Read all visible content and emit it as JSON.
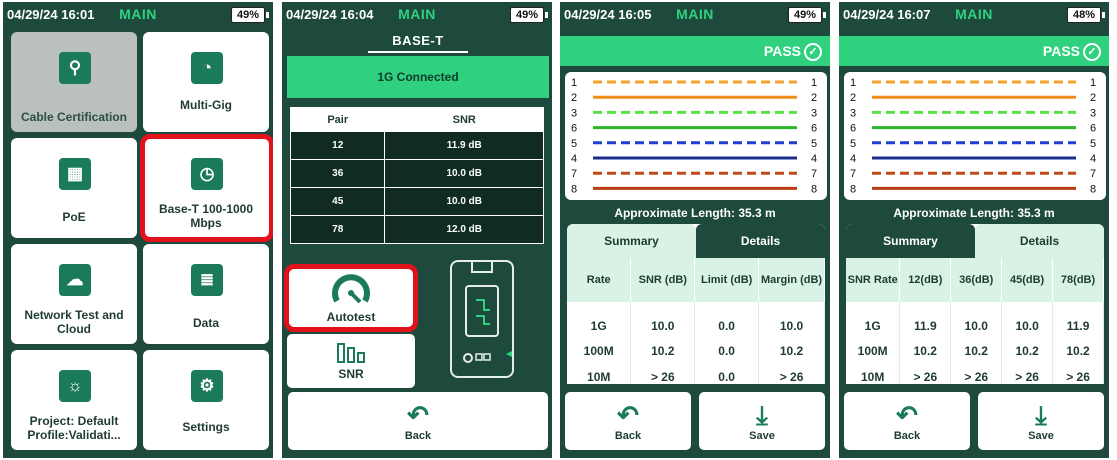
{
  "screens": [
    {
      "datetime": "04/29/24 16:01",
      "mode": "MAIN",
      "battery": "49%",
      "tiles": [
        {
          "label": "Cable Certification",
          "icon": "cable-icon"
        },
        {
          "label": "Multi-Gig",
          "icon": "speedometer-icon"
        },
        {
          "label": "PoE",
          "icon": "ethernet-port-icon"
        },
        {
          "label": "Base-T 100-1000 Mbps",
          "icon": "gauge-window-icon"
        },
        {
          "label": "Network Test and Cloud",
          "icon": "cloud-network-icon"
        },
        {
          "label": "Data",
          "icon": "database-icon"
        },
        {
          "label": "Project: Default Profile:Validati...",
          "icon": "lightbulb-icon"
        },
        {
          "label": "Settings",
          "icon": "gear-icon"
        }
      ]
    },
    {
      "datetime": "04/29/24 16:04",
      "mode": "MAIN",
      "battery": "49%",
      "title": "BASE-T",
      "status": "1G Connected",
      "table": {
        "headers": [
          "Pair",
          "SNR"
        ],
        "rows": [
          [
            "12",
            "11.9 dB"
          ],
          [
            "36",
            "10.0 dB"
          ],
          [
            "45",
            "10.0 dB"
          ],
          [
            "78",
            "12.0 dB"
          ]
        ]
      },
      "autotest_label": "Autotest",
      "snr_label": "SNR",
      "back_label": "Back"
    },
    {
      "datetime": "04/29/24 16:05",
      "mode": "MAIN",
      "battery": "49%",
      "result": "PASS",
      "wires_left": [
        "1",
        "2",
        "3",
        "6",
        "5",
        "4",
        "7",
        "8"
      ],
      "wires_right": [
        "1",
        "2",
        "3",
        "6",
        "5",
        "4",
        "7",
        "8"
      ],
      "length": "Approximate Length: 35.3 m",
      "tabs": [
        "Summary",
        "Details"
      ],
      "headers": [
        "Rate",
        "SNR (dB)",
        "Limit (dB)",
        "Margin (dB)"
      ],
      "rows": [
        [
          "1G",
          "10.0",
          "0.0",
          "10.0"
        ],
        [
          "100M",
          "10.2",
          "0.0",
          "10.2"
        ],
        [
          "10M",
          "> 26",
          "0.0",
          "> 26"
        ]
      ],
      "back_label": "Back",
      "save_label": "Save"
    },
    {
      "datetime": "04/29/24 16:07",
      "mode": "MAIN",
      "battery": "48%",
      "result": "PASS",
      "wires_left": [
        "1",
        "2",
        "3",
        "6",
        "5",
        "4",
        "7",
        "8"
      ],
      "wires_right": [
        "1",
        "2",
        "3",
        "6",
        "5",
        "4",
        "7",
        "8"
      ],
      "length": "Approximate Length: 35.3 m",
      "tabs": [
        "Summary",
        "Details"
      ],
      "headers": [
        "SNR Rate",
        "12(dB)",
        "36(dB)",
        "45(dB)",
        "78(dB)"
      ],
      "rows": [
        [
          "1G",
          "11.9",
          "10.0",
          "10.0",
          "11.9"
        ],
        [
          "100M",
          "10.2",
          "10.2",
          "10.2",
          "10.2"
        ],
        [
          "10M",
          "> 26",
          "> 26",
          "> 26",
          "> 26"
        ]
      ],
      "back_label": "Back",
      "save_label": "Save"
    }
  ],
  "colors": {
    "background": "#1d4a3c",
    "accent": "#2fd17f",
    "icon": "#1a7a5a",
    "highlight": "#e1121c",
    "wires": [
      "#f5a32a",
      "#f08c1a",
      "#5be04a",
      "#2cb52a",
      "#1f3fd1",
      "#1a2c8c",
      "#c04a1a",
      "#b83b12"
    ]
  }
}
